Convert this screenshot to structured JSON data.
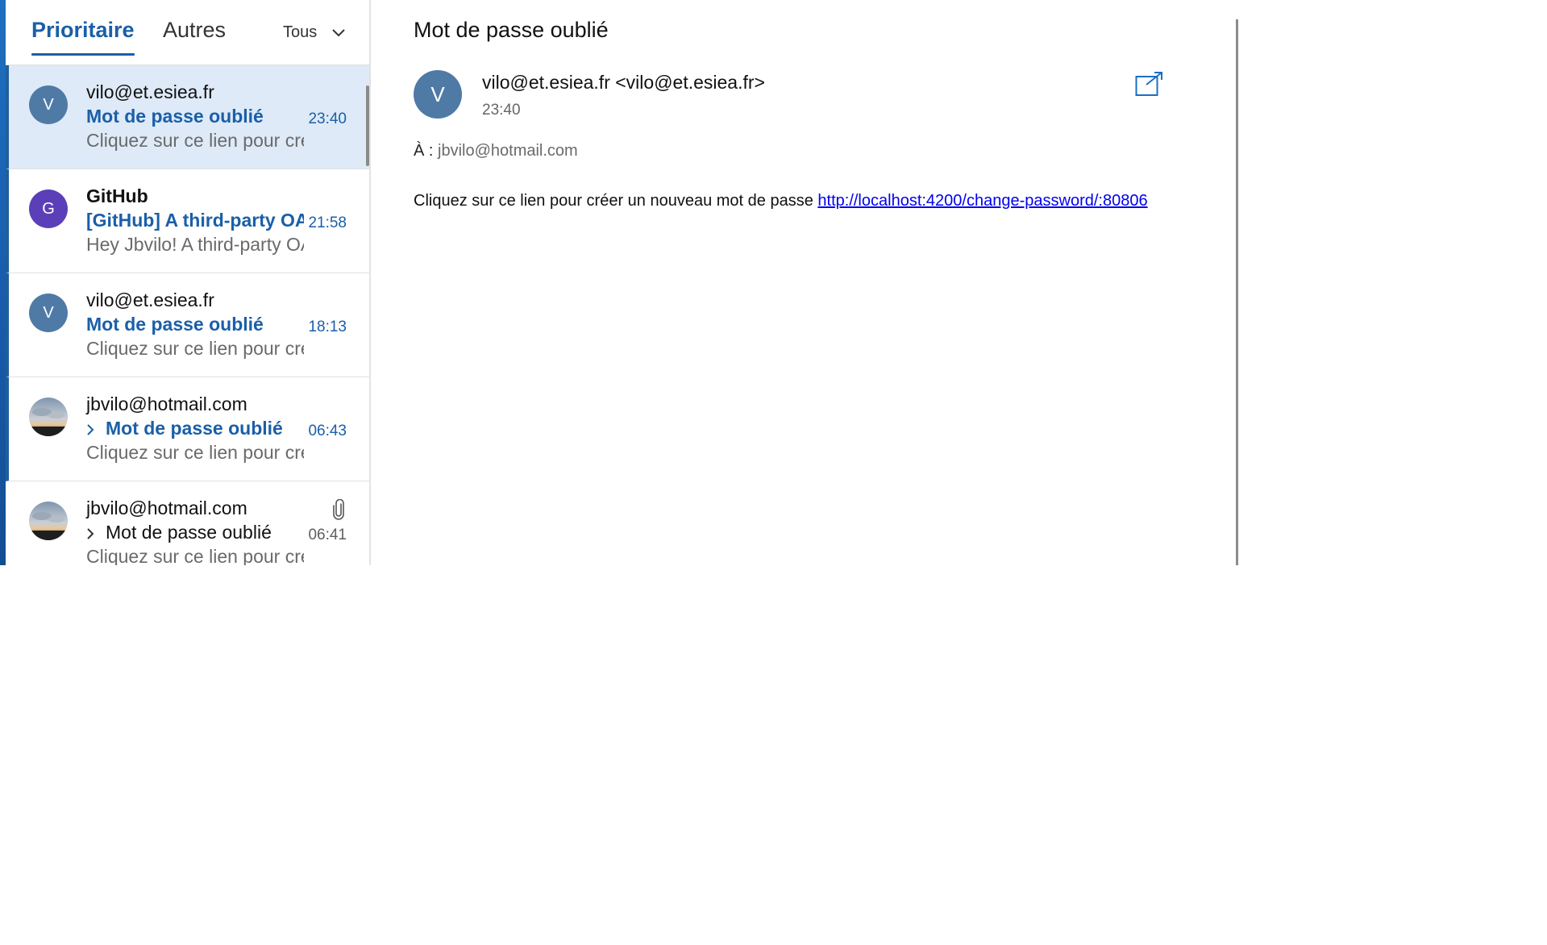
{
  "tabs": {
    "focused": "Prioritaire",
    "other": "Autres",
    "filter": "Tous"
  },
  "messages": [
    {
      "avatar_letter": "V",
      "avatar_color": "#4f7aa6",
      "sender": "vilo@et.esiea.fr",
      "subject": "Mot de passe oublié",
      "preview": "Cliquez sur ce lien pour créer un nouveau mot de passe",
      "time": "23:40",
      "selected": true,
      "unread": true
    },
    {
      "avatar_letter": "G",
      "avatar_color": "#5b3fb8",
      "sender": "GitHub",
      "subject": "[GitHub] A third-party OAuth application",
      "preview": "Hey Jbvilo! A third-party OAuth application",
      "time": "21:58",
      "unread": true
    },
    {
      "avatar_letter": "V",
      "avatar_color": "#4f7aa6",
      "sender": "vilo@et.esiea.fr",
      "subject": "Mot de passe oublié",
      "preview": "Cliquez sur ce lien pour créer un nouveau mot de passe",
      "time": "18:13",
      "unread": true
    },
    {
      "avatar_type": "photo",
      "sender": "jbvilo@hotmail.com",
      "subject": "Mot de passe oublié",
      "preview": "Cliquez sur ce lien pour créer un nouveau mot de passe",
      "time": "06:43",
      "thread": true,
      "unread": true
    },
    {
      "avatar_type": "photo",
      "sender": "jbvilo@hotmail.com",
      "subject": "Mot de passe oublié",
      "preview": "Cliquez sur ce lien pour créer un nouveau mot de passe",
      "time": "06:41",
      "thread": true,
      "attachment": true,
      "unread": false
    }
  ],
  "reading": {
    "subject": "Mot de passe oublié",
    "avatar_letter": "V",
    "from": "vilo@et.esiea.fr <vilo@et.esiea.fr>",
    "time": "23:40",
    "to_label": "À :",
    "to_address": "jbvilo@hotmail.com",
    "body_text": "Cliquez sur ce lien pour créer un nouveau mot de passe",
    "body_link": "http://localhost:4200/change-password/:80806"
  },
  "colors": {
    "accent": "#1a5fa8",
    "selected_bg": "#deeaf7",
    "link": "#0000ee"
  },
  "icons": {
    "filter": "chevron-down-icon",
    "thread": "chevron-right-icon",
    "attachment": "paperclip-icon",
    "popout": "open-in-new-window-icon"
  }
}
